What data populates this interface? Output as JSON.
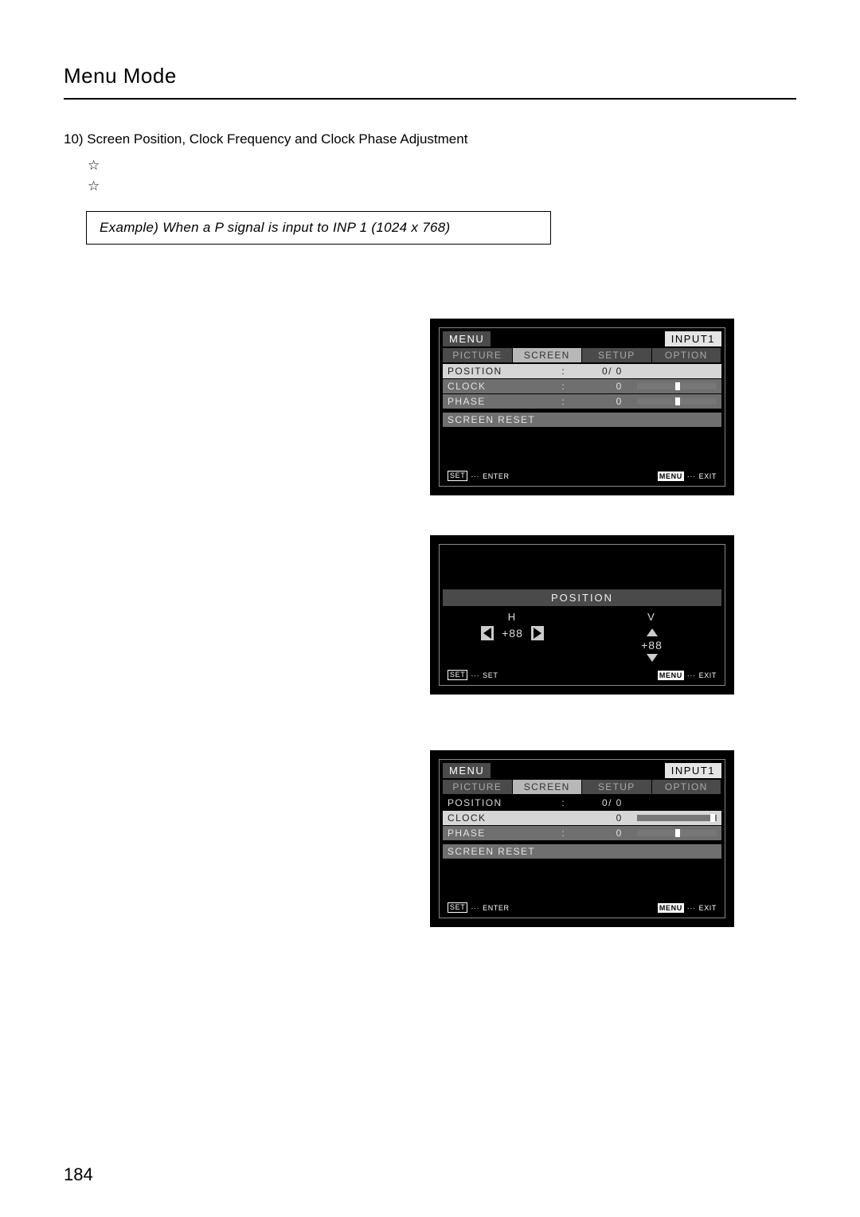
{
  "page_title": "Menu Mode",
  "section_head": "10) Screen Position, Clock Frequency and Clock Phase Adjustment",
  "star_glyph": "☆",
  "example_box": "Example) When a P    signal is input to INP    1 (1024 x 768)",
  "ghost1": "                                            '                   '",
  "ghost2": "              '             '",
  "ghost3": "                                    ' ☆            '",
  "ghost4": "                               '           '",
  "osd": {
    "menu_label": "MENU",
    "input_label": "INPUT1",
    "tabs": [
      "PICTURE",
      "SCREEN",
      "SETUP",
      "OPTION"
    ],
    "position": {
      "label": "POSITION",
      "value": "0/ 0"
    },
    "clock": {
      "label": "CLOCK",
      "value": "0"
    },
    "phase": {
      "label": "PHASE",
      "value": "0"
    },
    "reset": "SCREEN RESET",
    "footer_set": "SET",
    "footer_enter": "ENTER",
    "footer_menu": "MENU",
    "footer_exit": "EXIT"
  },
  "pos_panel": {
    "title": "POSITION",
    "h_label": "H",
    "v_label": "V",
    "h_value": "+88",
    "v_value": "+88",
    "footer_set": "SET",
    "footer_set2": "SET",
    "footer_menu": "MENU",
    "footer_exit": "EXIT"
  },
  "page_number": "184"
}
